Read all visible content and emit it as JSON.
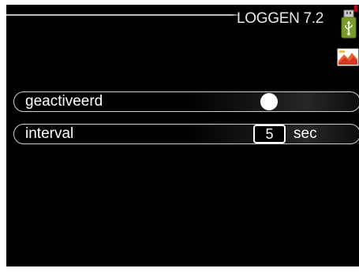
{
  "header": {
    "title": "LOGGEN 7.2",
    "icons": [
      "usb-icon",
      "alarm-icon"
    ]
  },
  "settings": [
    {
      "label": "geactiveerd",
      "control": "toggle",
      "value": "on"
    },
    {
      "label": "interval",
      "control": "number",
      "value": "5",
      "unit": "sec"
    }
  ],
  "colors": {
    "background": "#000000",
    "text": "#ffffff",
    "frame": "#cfcfcf",
    "usb_icon": "#7a9a2a",
    "indicator": "#cc0000"
  }
}
